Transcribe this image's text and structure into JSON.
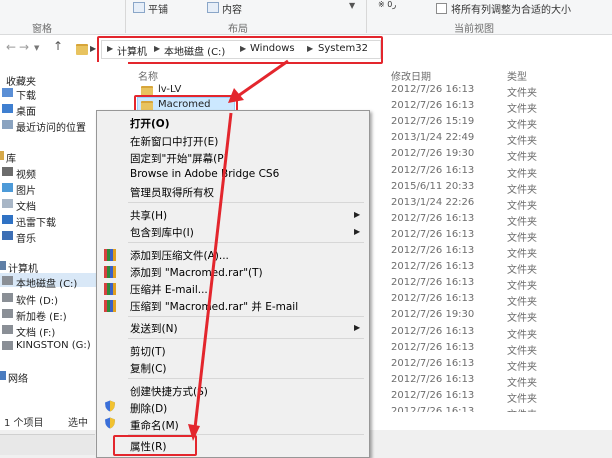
{
  "ribbon": {
    "group1_label": "窗格",
    "tile_label": "平铺",
    "content_label": "内容",
    "group2_label": "布局",
    "fit_label": "将所有列调整为合适的大小",
    "group3_label": "当前视图",
    "partial_top_text": "※ 0ر"
  },
  "address": {
    "crumbs": [
      "计算机",
      "本地磁盘 (C:)",
      "Windows",
      "System32"
    ]
  },
  "nav": {
    "favorites": "收藏夹",
    "downloads": "下载",
    "desktop": "桌面",
    "recent": "最近访问的位置",
    "library": "库",
    "videos": "视频",
    "pictures": "图片",
    "documents": "文档",
    "thunder": "迅雷下载",
    "music": "音乐",
    "computer": "计算机",
    "disk_c": "本地磁盘 (C:)",
    "disk_d": "软件 (D:)",
    "disk_e": "新加卷 (E:)",
    "disk_f": "文档 (F:)",
    "kingston": "KINGSTON (G:)",
    "network": "网络"
  },
  "columns": {
    "name": "名称",
    "date": "修改日期",
    "type": "类型"
  },
  "files": {
    "lv": "lv-LV",
    "macromed": "Macromed"
  },
  "dates": [
    "2012/7/26 16:13",
    "2012/7/26 16:13",
    "2012/7/26 15:19",
    "2013/1/24 22:49",
    "2012/7/26 19:30",
    "2012/7/26 16:13",
    "2015/6/11 20:33",
    "2013/1/24 22:26",
    "2012/7/26 16:13",
    "2012/7/26 16:13",
    "2012/7/26 16:13",
    "2012/7/26 16:13",
    "2012/7/26 16:13",
    "2012/7/26 16:13",
    "2012/7/26 19:30",
    "2012/7/26 16:13",
    "2012/7/26 16:13",
    "2012/7/26 16:13",
    "2012/7/26 16:13",
    "2012/7/26 16:13",
    "2012/7/26 16:13",
    "2015/7/7 17:21"
  ],
  "folder_type": "文件夹",
  "status": {
    "count": "1 个项目",
    "selected": "选中"
  },
  "menu": {
    "open": "打开(O)",
    "open_new_window": "在新窗口中打开(E)",
    "pin_start": "固定到\"开始\"屏幕(P)",
    "browse_bridge": "Browse in Adobe Bridge CS6",
    "admin_owner": "管理员取得所有权",
    "share": "共享(H)",
    "include_library": "包含到库中(I)",
    "add_archive": "添加到压缩文件(A)...",
    "add_to_rar": "添加到 \"Macromed.rar\"(T)",
    "compress_email": "压缩并 E-mail...",
    "compress_rar_email": "压缩到 \"Macromed.rar\" 并 E-mail",
    "send_to": "发送到(N)",
    "cut": "剪切(T)",
    "copy": "复制(C)",
    "create_shortcut": "创建快捷方式(S)",
    "delete": "删除(D)",
    "rename": "重命名(M)",
    "properties": "属性(R)"
  },
  "colors": {
    "highlight_red": "#e3262d",
    "folder_yellow": "#e8c35f",
    "menu_bg": "#f0f0f0"
  }
}
